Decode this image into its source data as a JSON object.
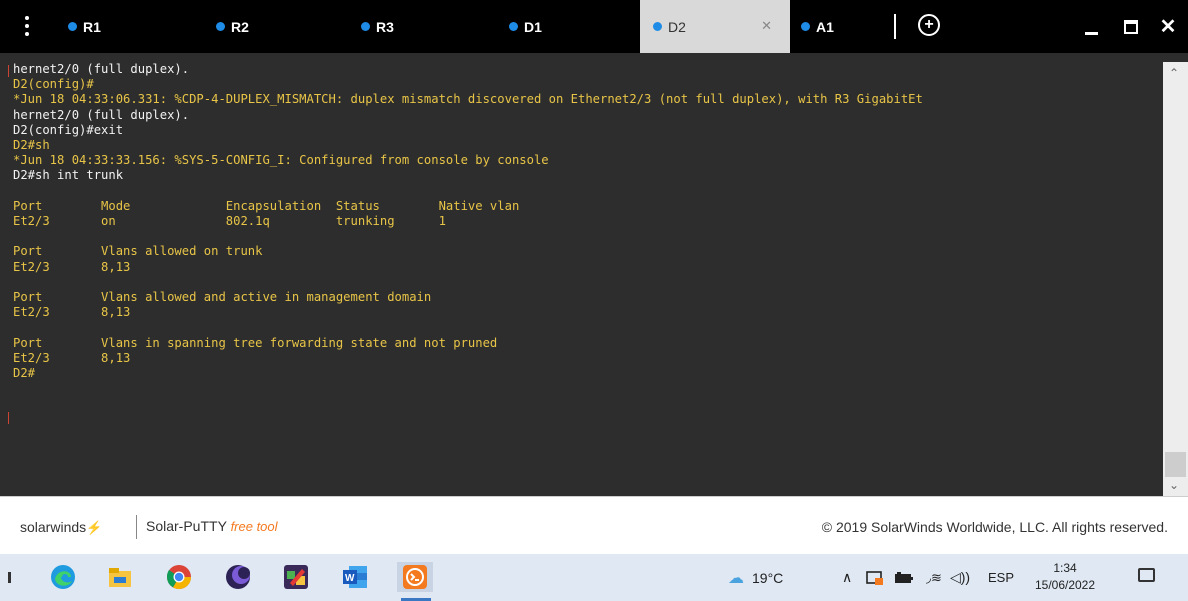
{
  "tabs": [
    {
      "label": "R1",
      "active": false
    },
    {
      "label": "R2",
      "active": false
    },
    {
      "label": "R3",
      "active": false
    },
    {
      "label": "D1",
      "active": false
    },
    {
      "label": "D2",
      "active": true
    },
    {
      "label": "A1",
      "active": false
    }
  ],
  "terminal": {
    "lines": [
      {
        "text": "hernet2/0 (full duplex).",
        "color": "white"
      },
      {
        "text": "D2(config)#",
        "color": "yellow"
      },
      {
        "text": "*Jun 18 04:33:06.331: %CDP-4-DUPLEX_MISMATCH: duplex mismatch discovered on Ethernet2/3 (not full duplex), with R3 GigabitEt",
        "color": "yellow"
      },
      {
        "text": "hernet2/0 (full duplex).",
        "color": "white"
      },
      {
        "text": "D2(config)#exit",
        "color": "white"
      },
      {
        "text": "D2#sh",
        "color": "yellow"
      },
      {
        "text": "*Jun 18 04:33:33.156: %SYS-5-CONFIG_I: Configured from console by console",
        "color": "yellow"
      },
      {
        "text": "D2#sh int trunk",
        "color": "white"
      },
      {
        "text": "",
        "color": "white"
      },
      {
        "text": "Port        Mode             Encapsulation  Status        Native vlan",
        "color": "yellow"
      },
      {
        "text": "Et2/3       on               802.1q         trunking      1",
        "color": "yellow"
      },
      {
        "text": "",
        "color": "white"
      },
      {
        "text": "Port        Vlans allowed on trunk",
        "color": "yellow"
      },
      {
        "text": "Et2/3       8,13",
        "color": "yellow"
      },
      {
        "text": "",
        "color": "white"
      },
      {
        "text": "Port        Vlans allowed and active in management domain",
        "color": "yellow"
      },
      {
        "text": "Et2/3       8,13",
        "color": "yellow"
      },
      {
        "text": "",
        "color": "white"
      },
      {
        "text": "Port        Vlans in spanning tree forwarding state and not pruned",
        "color": "yellow"
      },
      {
        "text": "Et2/3       8,13",
        "color": "yellow"
      },
      {
        "text": "D2#",
        "color": "yellow"
      }
    ]
  },
  "footer": {
    "logo": "solarwinds",
    "app_name": "Solar-PuTTY",
    "free_tag": "free tool",
    "copyright": "© 2019 SolarWinds Worldwide, LLC. All rights reserved."
  },
  "taskbar": {
    "icons": [
      "edge-icon",
      "file-explorer-icon",
      "chrome-icon",
      "eclipse-icon",
      "paint-icon",
      "word-icon",
      "solar-putty-icon"
    ],
    "weather": "19°C",
    "language": "ESP",
    "time": "1:34",
    "date": "15/06/2022"
  },
  "colors": {
    "terminal_bg": "#2d2d2d",
    "terminal_yellow": "#e8c547",
    "tab_dot": "#1e8ce6",
    "brand_orange": "#f47a20"
  }
}
